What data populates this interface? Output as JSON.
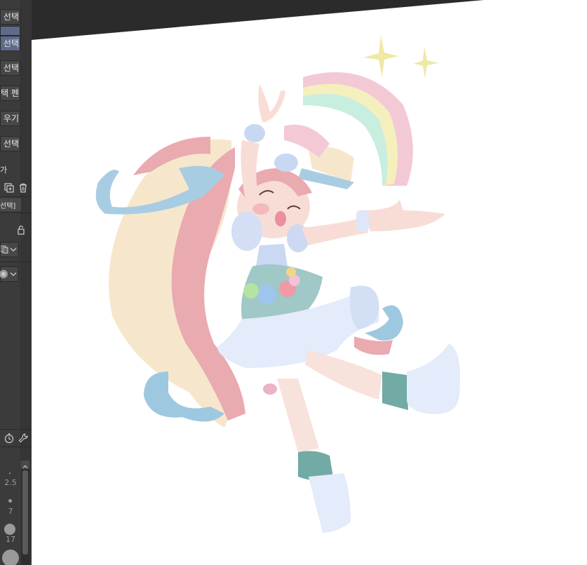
{
  "subtool_list": {
    "items": [
      {
        "label": "선택",
        "selected": false
      },
      {
        "label": "",
        "selected": true
      },
      {
        "label": "선택",
        "selected": false
      },
      {
        "label": "선택",
        "selected": false
      },
      {
        "label": "택 펜",
        "selected": false
      },
      {
        "label": "우기",
        "selected": false
      },
      {
        "label": "선택",
        "selected": false
      }
    ],
    "footer_label": "가"
  },
  "tool_property": {
    "title": "선택]"
  },
  "brush_sizes": [
    "2.5",
    "7",
    "17"
  ],
  "colors": {
    "panel_bg": "#3b3b3b",
    "selected_bg": "#5f6a8a",
    "canvas_bg": "#ffffff",
    "top_strip": "#2b2b2b"
  }
}
